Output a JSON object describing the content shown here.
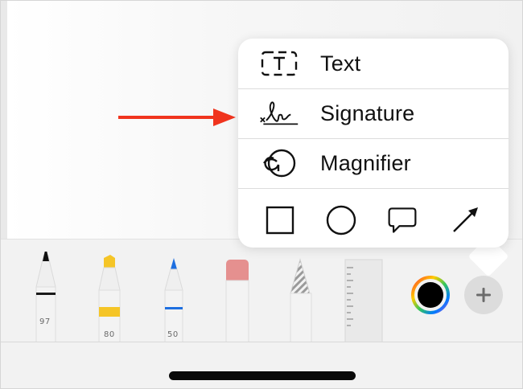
{
  "menu": {
    "items": [
      {
        "label": "Text",
        "icon": "text-box-icon"
      },
      {
        "label": "Signature",
        "icon": "signature-icon"
      },
      {
        "label": "Magnifier",
        "icon": "magnifier-icon"
      }
    ],
    "shapes": [
      "square-shape-icon",
      "circle-shape-icon",
      "speech-bubble-icon",
      "arrow-shape-icon"
    ]
  },
  "tools": [
    {
      "name": "pen",
      "number": "97",
      "accent": "#1a1a1a"
    },
    {
      "name": "highlighter",
      "number": "80",
      "accent": "#f5c527"
    },
    {
      "name": "pencil",
      "number": "50",
      "accent": "#1e6fe0"
    },
    {
      "name": "eraser",
      "number": "",
      "accent": "#e5908f"
    },
    {
      "name": "lasso",
      "number": "",
      "accent": "#bdbdbd"
    },
    {
      "name": "ruler",
      "number": "",
      "accent": "#dcdcdc"
    }
  ],
  "colors": {
    "annotation_arrow": "#f0341e",
    "selected_color": "#000000"
  }
}
